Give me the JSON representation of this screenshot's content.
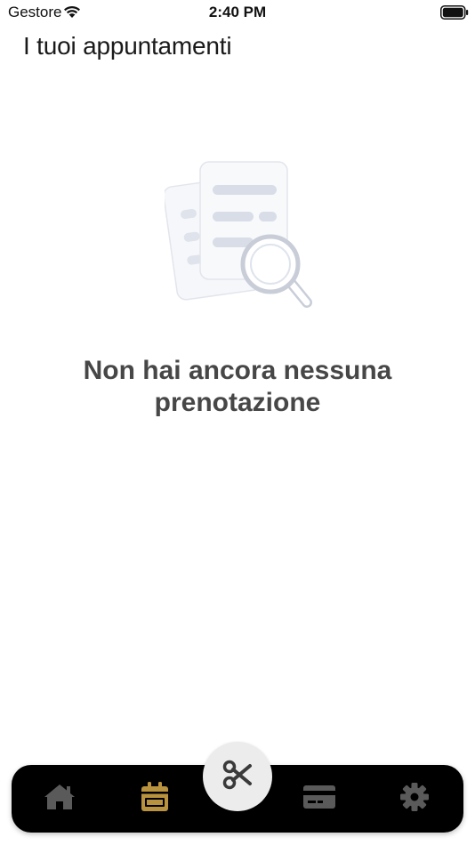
{
  "status_bar": {
    "carrier": "Gestore",
    "time": "2:40 PM"
  },
  "header": {
    "title": "I tuoi appuntamenti"
  },
  "empty_state": {
    "message": "Non hai ancora nessuna prenotazione",
    "illustration_icon": "document-search-icon"
  },
  "tab_bar": {
    "items": [
      {
        "icon": "home-icon",
        "active": false
      },
      {
        "icon": "calendar-icon",
        "active": true
      },
      {
        "icon": "scissors-icon",
        "center": true
      },
      {
        "icon": "credit-card-icon",
        "active": false
      },
      {
        "icon": "gear-icon",
        "active": false
      }
    ]
  },
  "colors": {
    "accent": "#B8923E",
    "tab_icon": "#5a5a5a",
    "tab_bar": "#000000",
    "text_dark": "#474747"
  }
}
